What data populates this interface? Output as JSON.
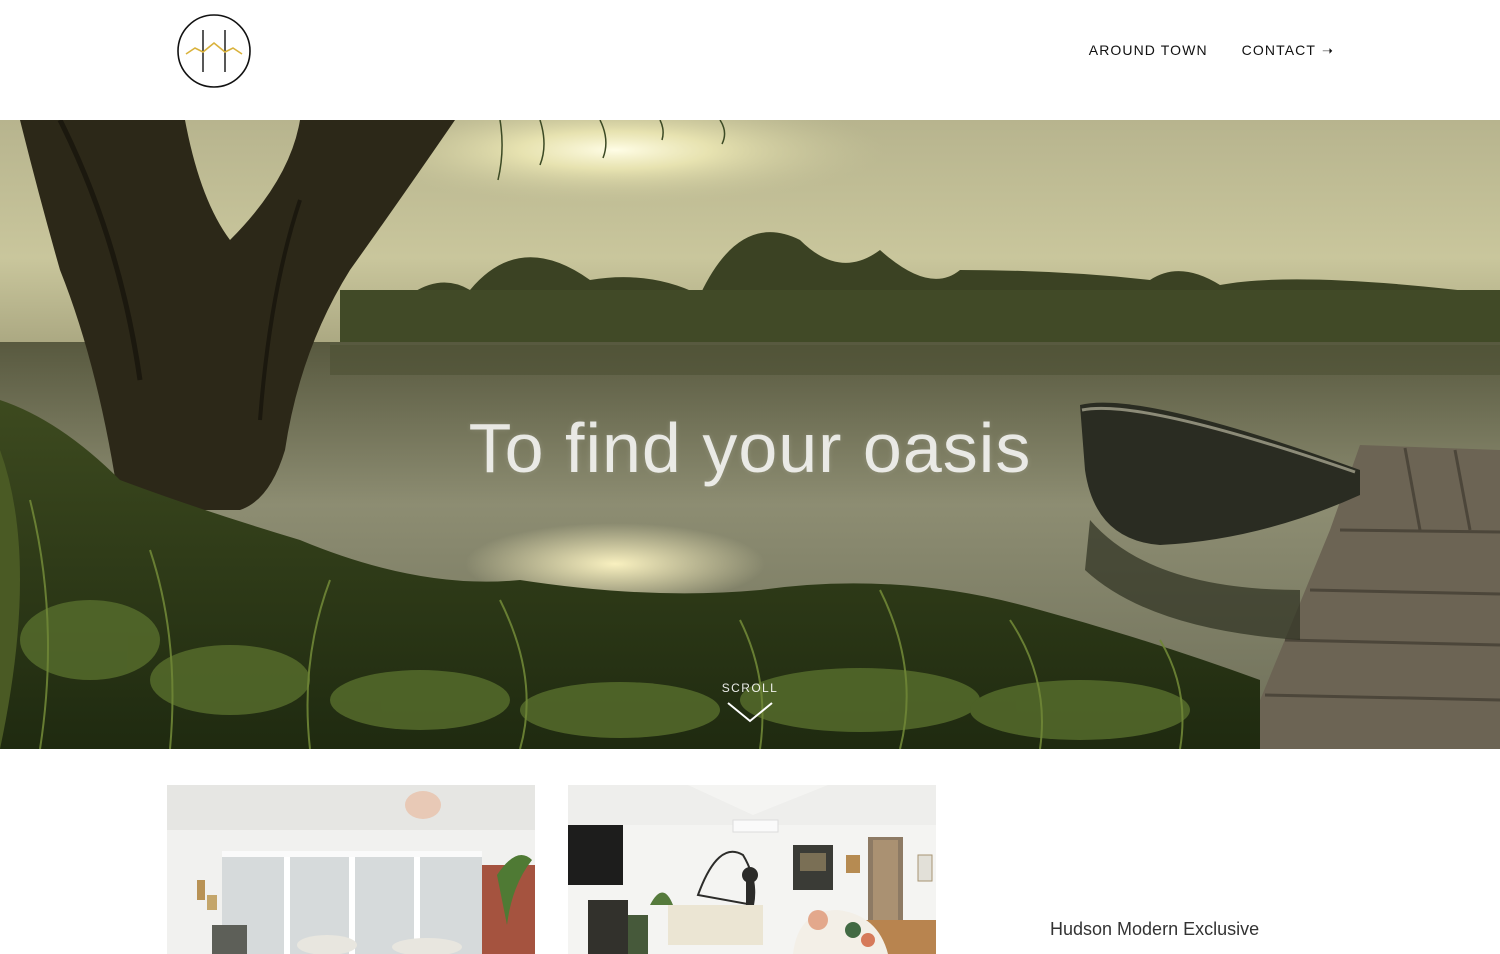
{
  "header": {
    "logo_name": "circle-h-logo",
    "nav": [
      {
        "label": "AROUND TOWN",
        "arrow": ""
      },
      {
        "label": "CONTACT",
        "arrow": "➝"
      }
    ]
  },
  "hero": {
    "headline": "To find your oasis",
    "scroll_label": "SCROLL",
    "scroll_icon": "chevron-down-icon"
  },
  "listings": {
    "title": "Hudson Modern Exclusive"
  },
  "colors": {
    "logo_accent": "#d9b23c",
    "text": "#111111"
  }
}
